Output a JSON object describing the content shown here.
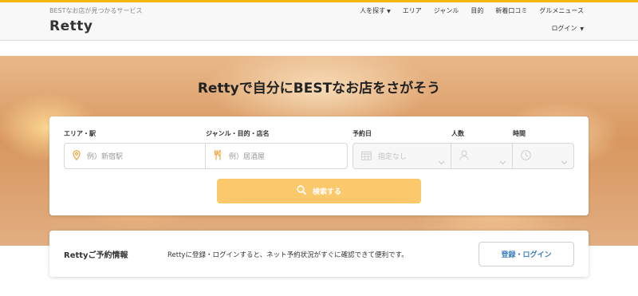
{
  "header": {
    "tagline": "BESTなお店が見つかるサービス",
    "logo": "Retty",
    "nav": {
      "people_search": "人を探す",
      "area": "エリア",
      "genre": "ジャンル",
      "purpose": "目的",
      "new_reviews": "新着口コミ",
      "gourmet_news": "グルメニュース"
    },
    "login": "ログイン"
  },
  "hero": {
    "title": "Rettyで自分にBESTなお店をさがそう"
  },
  "search": {
    "area_label": "エリア・駅",
    "area_placeholder": "例）新宿駅",
    "genre_label": "ジャンル・目的・店名",
    "genre_placeholder": "例）居酒屋",
    "date_label": "予約日",
    "date_value": "指定なし",
    "people_label": "人数",
    "time_label": "時間",
    "button": "検索する"
  },
  "reservation": {
    "title": "Rettyご予約情報",
    "description": "Rettyに登録・ログインすると、ネット予約状況がすぐに確認できて便利です。",
    "button": "登録・ログイン"
  },
  "colors": {
    "accent": "#f7b500",
    "search_button": "#fbc86b",
    "link_blue": "#3a7cc2",
    "pin_orange": "#f3a23c"
  }
}
